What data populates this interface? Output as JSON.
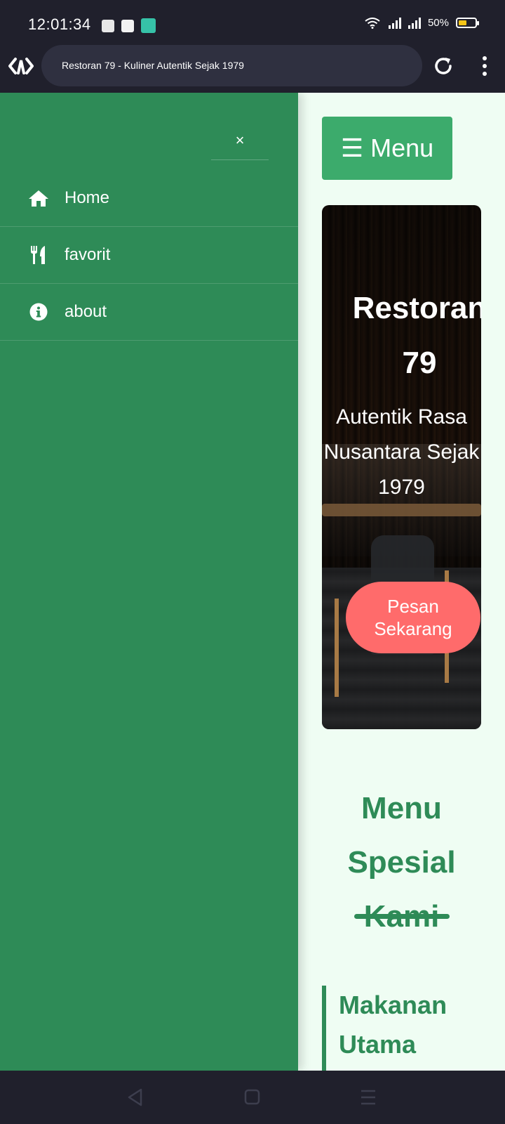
{
  "status_bar": {
    "time": "12:01:34",
    "battery": "50%",
    "battery_level": 0.5,
    "notification_icons": [
      "discord-icon",
      "shopping-bag-icon",
      "chat-app-icon"
    ],
    "status_icons": [
      "wifi-icon",
      "signal-icon",
      "signal-icon",
      "battery-icon"
    ]
  },
  "browser": {
    "url_title": "Restoran 79 - Kuliner Autentik Sejak 1979",
    "icons": [
      "browser-logo-icon",
      "reload-icon",
      "more-vert-icon"
    ]
  },
  "sidebar": {
    "close_label": "×",
    "items": [
      {
        "label": "Home",
        "icon": "home-icon"
      },
      {
        "label": "favorit",
        "icon": "utensils-icon"
      },
      {
        "label": "about",
        "icon": "info-icon"
      }
    ]
  },
  "main": {
    "menu_button": "☰ Menu",
    "hero": {
      "title": "Restoran 79",
      "subtitle": "Autentik Rasa Nusantara Sejak 1979",
      "cta": "Pesan Sekarang"
    },
    "section_title": "Menu Spesial Kami",
    "category_title": "Makanan Utama"
  },
  "system_nav": [
    "back-icon",
    "home-square-icon",
    "recents-icon"
  ],
  "colors": {
    "primary_green": "#2e8b57",
    "button_green": "#3cab6c",
    "cta_red": "#ff6b6b",
    "page_bg": "#effdf3",
    "chrome_dark": "#20202c"
  }
}
